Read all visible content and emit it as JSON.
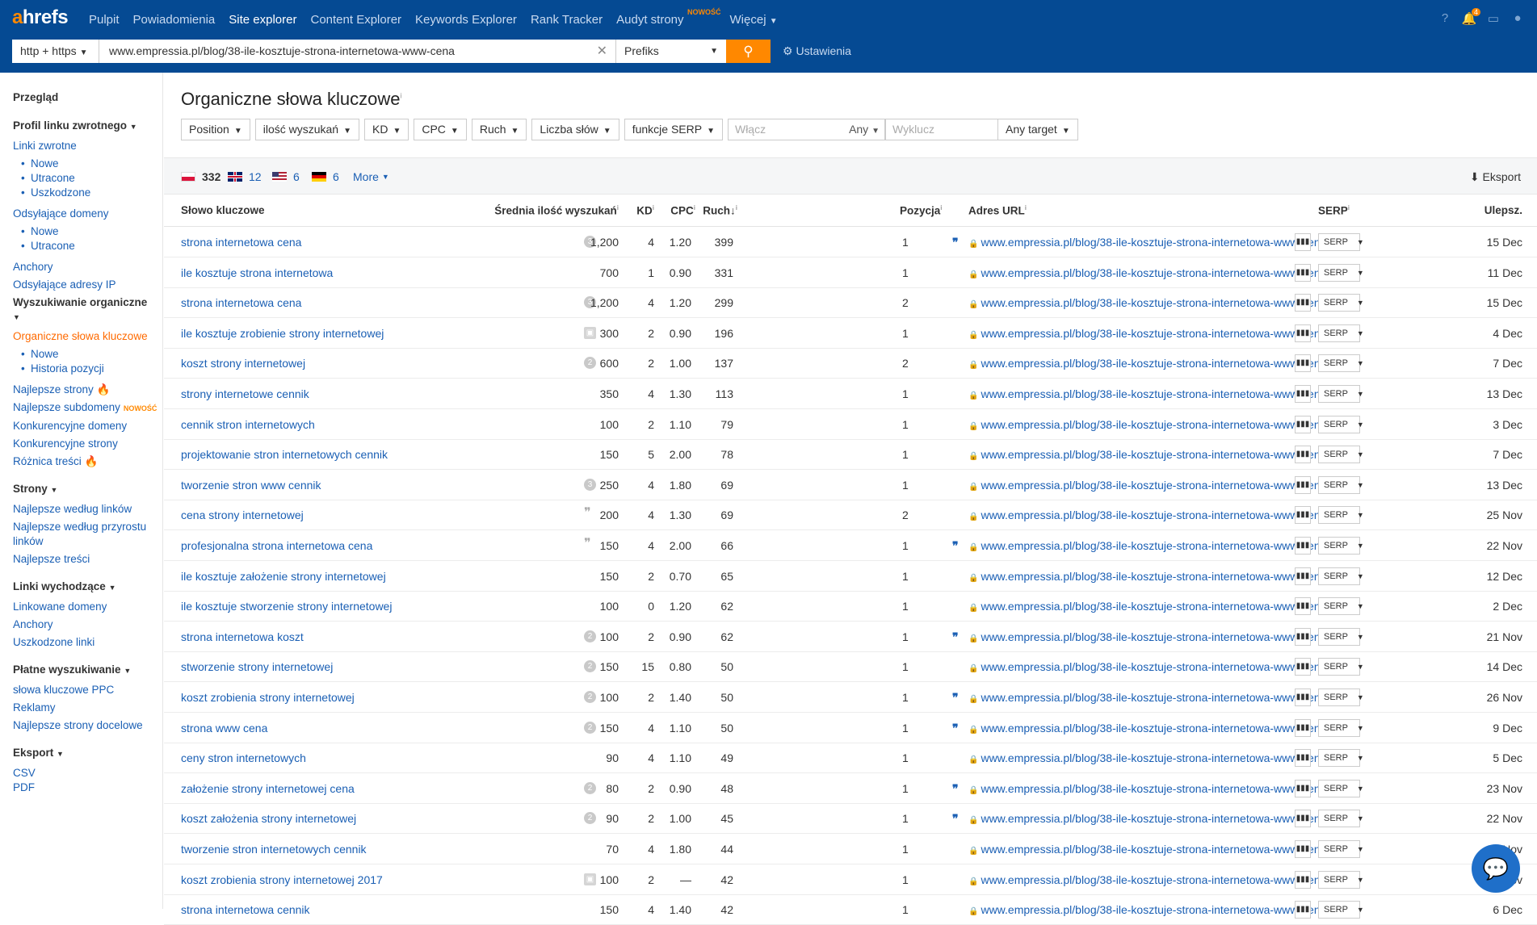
{
  "logo": "ahrefs",
  "nav": {
    "items": [
      "Pulpit",
      "Powiadomienia",
      "Site explorer",
      "Content Explorer",
      "Keywords Explorer",
      "Rank Tracker",
      "Audyt strony"
    ],
    "new_badge": "NOWOŚĆ",
    "more": "Więcej",
    "notif_count": "4"
  },
  "search": {
    "protocol": "http + https",
    "url": "www.empressia.pl/blog/38-ile-kosztuje-strona-internetowa-www-cena",
    "mode": "Prefiks",
    "settings": "Ustawienia"
  },
  "sidebar": {
    "overview": "Przegląd",
    "backlink_profile": "Profil linku zwrotnego",
    "backlinks": "Linki zwrotne",
    "new": "Nowe",
    "lost": "Utracone",
    "broken": "Uszkodzone",
    "ref_domains": "Odsyłające domeny",
    "ref_new": "Nowe",
    "ref_lost": "Utracone",
    "anchors": "Anchory",
    "ref_ips": "Odsyłające adresy IP",
    "organic_search": "Wyszukiwanie organiczne",
    "organic_keywords": "Organiczne słowa kluczowe",
    "ok_new": "Nowe",
    "ok_history": "Historia pozycji",
    "top_pages": "Najlepsze strony",
    "top_subdomains": "Najlepsze subdomeny",
    "new_badge": "NOWOŚĆ",
    "competing_domains": "Konkurencyjne domeny",
    "competing_pages": "Konkurencyjne strony",
    "content_gap": "Różnica treści",
    "pages": "Strony",
    "best_by_links": "Najlepsze według linków",
    "best_by_growth": "Najlepsze według przyrostu linków",
    "top_content": "Najlepsze treści",
    "outgoing_links": "Linki wychodzące",
    "linked_domains": "Linkowane domeny",
    "out_anchors": "Anchory",
    "broken_links": "Uszkodzone linki",
    "paid_search": "Płatne wyszukiwanie",
    "ppc_keywords": "słowa kluczowe PPC",
    "ads": "Reklamy",
    "top_landing": "Najlepsze strony docelowe",
    "export": "Eksport",
    "csv": "CSV",
    "pdf": "PDF"
  },
  "main": {
    "title": "Organiczne słowa kluczowe",
    "filters": [
      "Position",
      "ilość wyszukań",
      "KD",
      "CPC",
      "Ruch",
      "Liczba słów",
      "funkcje SERP"
    ],
    "include_placeholder": "Włącz",
    "any": "Any",
    "exclude_placeholder": "Wyklucz",
    "any_target": "Any target",
    "countries": [
      {
        "count": "332",
        "flag": "pl"
      },
      {
        "count": "12",
        "flag": "gb"
      },
      {
        "count": "6",
        "flag": "us"
      },
      {
        "count": "6",
        "flag": "de"
      }
    ],
    "more": "More",
    "export": "Eksport",
    "headers": {
      "keyword": "Słowo kluczowe",
      "volume": "Średnia ilość wyszukań",
      "kd": "KD",
      "cpc": "CPC",
      "traffic": "Ruch",
      "position": "Pozycja",
      "url": "Adres URL",
      "serp": "SERP",
      "updated": "Ulepsz."
    },
    "serp_label": "SERP",
    "url_text": "www.empressia.pl/blog/38-ile-kosztuje-strona-internetowa-www-cena",
    "rows": [
      {
        "kw": "strona internetowa cena",
        "feat": "3",
        "vol": "1,200",
        "kd": "4",
        "cpc": "1.20",
        "trf": "399",
        "pos": "1",
        "quote": true,
        "upd": "15 Dec"
      },
      {
        "kw": "ile kosztuje strona internetowa",
        "feat": "",
        "vol": "700",
        "kd": "1",
        "cpc": "0.90",
        "trf": "331",
        "pos": "1",
        "quote": false,
        "upd": "11 Dec"
      },
      {
        "kw": "strona internetowa cena",
        "feat": "3",
        "vol": "1,200",
        "kd": "4",
        "cpc": "1.20",
        "trf": "299",
        "pos": "2",
        "quote": false,
        "upd": "15 Dec"
      },
      {
        "kw": "ile kosztuje zrobienie strony internetowej",
        "feat": "img",
        "vol": "300",
        "kd": "2",
        "cpc": "0.90",
        "trf": "196",
        "pos": "1",
        "quote": false,
        "upd": "4 Dec"
      },
      {
        "kw": "koszt strony internetowej",
        "feat": "2",
        "vol": "600",
        "kd": "2",
        "cpc": "1.00",
        "trf": "137",
        "pos": "2",
        "quote": false,
        "upd": "7 Dec"
      },
      {
        "kw": "strony internetowe cennik",
        "feat": "",
        "vol": "350",
        "kd": "4",
        "cpc": "1.30",
        "trf": "113",
        "pos": "1",
        "quote": false,
        "upd": "13 Dec"
      },
      {
        "kw": "cennik stron internetowych",
        "feat": "",
        "vol": "100",
        "kd": "2",
        "cpc": "1.10",
        "trf": "79",
        "pos": "1",
        "quote": false,
        "upd": "3 Dec"
      },
      {
        "kw": "projektowanie stron internetowych cennik",
        "feat": "",
        "vol": "150",
        "kd": "5",
        "cpc": "2.00",
        "trf": "78",
        "pos": "1",
        "quote": false,
        "upd": "7 Dec"
      },
      {
        "kw": "tworzenie stron www cennik",
        "feat": "3",
        "vol": "250",
        "kd": "4",
        "cpc": "1.80",
        "trf": "69",
        "pos": "1",
        "quote": false,
        "upd": "13 Dec"
      },
      {
        "kw": "cena strony internetowej",
        "feat": "q",
        "vol": "200",
        "kd": "4",
        "cpc": "1.30",
        "trf": "69",
        "pos": "2",
        "quote": false,
        "upd": "25 Nov"
      },
      {
        "kw": "profesjonalna strona internetowa cena",
        "feat": "q",
        "vol": "150",
        "kd": "4",
        "cpc": "2.00",
        "trf": "66",
        "pos": "1",
        "quote": true,
        "upd": "22 Nov"
      },
      {
        "kw": "ile kosztuje założenie strony internetowej",
        "feat": "",
        "vol": "150",
        "kd": "2",
        "cpc": "0.70",
        "trf": "65",
        "pos": "1",
        "quote": false,
        "upd": "12 Dec"
      },
      {
        "kw": "ile kosztuje stworzenie strony internetowej",
        "feat": "",
        "vol": "100",
        "kd": "0",
        "cpc": "1.20",
        "trf": "62",
        "pos": "1",
        "quote": false,
        "upd": "2 Dec"
      },
      {
        "kw": "strona internetowa koszt",
        "feat": "2",
        "vol": "100",
        "kd": "2",
        "cpc": "0.90",
        "trf": "62",
        "pos": "1",
        "quote": true,
        "upd": "21 Nov"
      },
      {
        "kw": "stworzenie strony internetowej",
        "feat": "2",
        "vol": "150",
        "kd": "15",
        "cpc": "0.80",
        "trf": "50",
        "pos": "1",
        "quote": false,
        "upd": "14 Dec"
      },
      {
        "kw": "koszt zrobienia strony internetowej",
        "feat": "2",
        "vol": "100",
        "kd": "2",
        "cpc": "1.40",
        "trf": "50",
        "pos": "1",
        "quote": true,
        "upd": "26 Nov"
      },
      {
        "kw": "strona www cena",
        "feat": "2",
        "vol": "150",
        "kd": "4",
        "cpc": "1.10",
        "trf": "50",
        "pos": "1",
        "quote": true,
        "upd": "9 Dec"
      },
      {
        "kw": "ceny stron internetowych",
        "feat": "",
        "vol": "90",
        "kd": "4",
        "cpc": "1.10",
        "trf": "49",
        "pos": "1",
        "quote": false,
        "upd": "5 Dec"
      },
      {
        "kw": "założenie strony internetowej cena",
        "feat": "2",
        "vol": "80",
        "kd": "2",
        "cpc": "0.90",
        "trf": "48",
        "pos": "1",
        "quote": true,
        "upd": "23 Nov"
      },
      {
        "kw": "koszt założenia strony internetowej",
        "feat": "2",
        "vol": "90",
        "kd": "2",
        "cpc": "1.00",
        "trf": "45",
        "pos": "1",
        "quote": true,
        "upd": "22 Nov"
      },
      {
        "kw": "tworzenie stron internetowych cennik",
        "feat": "",
        "vol": "70",
        "kd": "4",
        "cpc": "1.80",
        "trf": "44",
        "pos": "1",
        "quote": false,
        "upd": "30 Nov"
      },
      {
        "kw": "koszt zrobienia strony internetowej 2017",
        "feat": "img",
        "vol": "100",
        "kd": "2",
        "cpc": "—",
        "trf": "42",
        "pos": "1",
        "quote": false,
        "upd": "30 Nov"
      },
      {
        "kw": "strona internetowa cennik",
        "feat": "",
        "vol": "150",
        "kd": "4",
        "cpc": "1.40",
        "trf": "42",
        "pos": "1",
        "quote": false,
        "upd": "6 Dec"
      }
    ]
  }
}
